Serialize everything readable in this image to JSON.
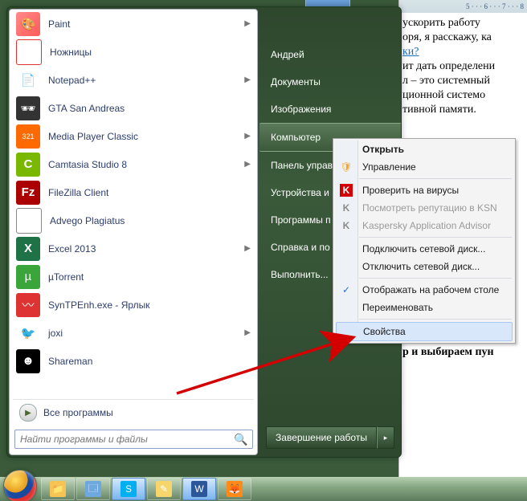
{
  "background_doc": {
    "ruler": "5 · · · 6 · · · 7 · · · 8",
    "line1": " ускорить работу ",
    "line2": "оря, я расскажу, ка",
    "link": "ки?",
    "line3": "ит дать определени",
    "line4": "л – это системный ",
    "line5": "ционной системо",
    "line6": "тивной памяти.",
    "hang": "р и выбираем пун"
  },
  "start_left_apps": [
    {
      "icon": "paint-icon",
      "cls": "bg-paint",
      "glyph": "🎨",
      "label": "Paint",
      "sub": true
    },
    {
      "icon": "scissors-icon",
      "cls": "bg-snip",
      "glyph": "✂",
      "label": "Ножницы",
      "sub": false
    },
    {
      "icon": "notepadpp-icon",
      "cls": "bg-npp",
      "glyph": "📄",
      "label": "Notepad++",
      "sub": true
    },
    {
      "icon": "gta-icon",
      "cls": "bg-gta",
      "glyph": "🕶",
      "label": "GTA San Andreas",
      "sub": false
    },
    {
      "icon": "mpc-icon",
      "cls": "bg-mpc",
      "glyph": "321",
      "label": "Media Player Classic",
      "sub": true
    },
    {
      "icon": "camtasia-icon",
      "cls": "bg-cam",
      "glyph": "C",
      "label": "Camtasia Studio 8",
      "sub": true
    },
    {
      "icon": "filezilla-icon",
      "cls": "bg-fz",
      "glyph": "Fz",
      "label": "FileZilla Client",
      "sub": false
    },
    {
      "icon": "advego-icon",
      "cls": "bg-adv",
      "glyph": "A",
      "label": "Advego Plagiatus",
      "sub": false
    },
    {
      "icon": "excel-icon",
      "cls": "bg-xl",
      "glyph": "X",
      "label": "Excel 2013",
      "sub": true
    },
    {
      "icon": "utorrent-icon",
      "cls": "bg-ut",
      "glyph": "µ",
      "label": "µTorrent",
      "sub": false
    },
    {
      "icon": "syntp-icon",
      "cls": "bg-syn",
      "glyph": "〰",
      "label": "SynTPEnh.exe - Ярлык",
      "sub": false
    },
    {
      "icon": "joxi-icon",
      "cls": "bg-joxi",
      "glyph": "🐦",
      "label": "joxi",
      "sub": true
    },
    {
      "icon": "shareman-icon",
      "cls": "bg-sh",
      "glyph": "☻",
      "label": "Shareman",
      "sub": false
    }
  ],
  "all_programs_label": "Все программы",
  "search_placeholder": "Найти программы и файлы",
  "start_right": {
    "items": [
      "Андрей",
      "Документы",
      "Изображения",
      "Компьютер",
      "Панель управ",
      "Устройства и ",
      "Программы п",
      "Справка и по",
      "Выполнить..."
    ],
    "highlight_index": 3
  },
  "shutdown": {
    "label": "Завершение работы",
    "chev": "▸"
  },
  "context_menu": {
    "items": [
      {
        "label": "Открыть",
        "bold": true
      },
      {
        "label": "Управление",
        "icon": "shield-icon",
        "iconCls": "bg-shield",
        "glyph": "🛡"
      },
      {
        "sep": true
      },
      {
        "label": "Проверить на вирусы",
        "icon": "kaspersky-icon",
        "iconCls": "bg-kred",
        "glyph": "K"
      },
      {
        "label": "Посмотреть репутацию в KSN",
        "icon": "ksn-icon",
        "iconCls": "bg-kg",
        "glyph": "K",
        "disabled": true
      },
      {
        "label": "Kaspersky Application Advisor",
        "icon": "kaa-icon",
        "iconCls": "bg-kg",
        "glyph": "K",
        "disabled": true
      },
      {
        "sep": true
      },
      {
        "label": "Подключить сетевой диск..."
      },
      {
        "label": "Отключить сетевой диск..."
      },
      {
        "sep": true
      },
      {
        "label": "Отображать на рабочем столе",
        "icon": "check-icon",
        "iconCls": "bg-chk",
        "glyph": "✓"
      },
      {
        "label": "Переименовать"
      },
      {
        "sep": true
      },
      {
        "label": "Свойства",
        "highlight": true
      }
    ]
  },
  "taskbar": {
    "buttons": [
      {
        "name": "explorer",
        "bg": "#f6c453",
        "glyph": "📁"
      },
      {
        "name": "library",
        "bg": "#6fa8df",
        "glyph": "🗔"
      },
      {
        "name": "skype",
        "bg": "#00aff0",
        "glyph": "S",
        "active": true
      },
      {
        "name": "sticky",
        "bg": "#f6d66a",
        "glyph": "✎"
      },
      {
        "name": "word",
        "bg": "#2b579a",
        "glyph": "W",
        "active": true
      },
      {
        "name": "firefox",
        "bg": "#ff8a1a",
        "glyph": "🦊"
      }
    ]
  }
}
